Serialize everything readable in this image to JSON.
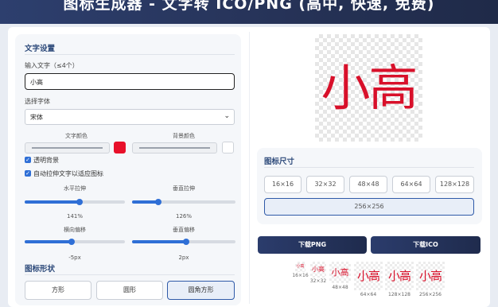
{
  "header": {
    "title": "图标生成器 - 文字转 ICO/PNG (高中, 快速, 免费)"
  },
  "text_settings": {
    "section_title": "文字设置",
    "input_label": "输入文字（≤4个）",
    "input_value": "小高",
    "font_label": "选择字体",
    "font_value": "宋体",
    "text_color_label": "文字颜色",
    "bg_color_label": "背景颜色",
    "text_color": "#e8102a",
    "bg_color": "#ffffff",
    "transparent_label": "透明背景",
    "transparent_checked": true,
    "autostretch_label": "自动拉伸文字以适应图标",
    "autostretch_checked": true,
    "h_stretch_label": "水平拉伸",
    "h_stretch_value": "141%",
    "v_stretch_label": "垂直拉伸",
    "v_stretch_value": "126%",
    "h_offset_label": "横向偏移",
    "h_offset_value": "-5px",
    "v_offset_label": "垂直偏移",
    "v_offset_value": "2px",
    "h_stretch_level": 0.55,
    "v_stretch_level": 0.25,
    "h_offset_level": 0.47,
    "v_offset_level": 0.52
  },
  "shape": {
    "section_title": "图标形状",
    "options": [
      "方形",
      "圆形",
      "圆角方形"
    ],
    "selected": "圆角方形"
  },
  "preview": {
    "text": "小高",
    "accent": "#d8102a"
  },
  "sizes": {
    "section_title": "图标尺寸",
    "options": [
      "16×16",
      "32×32",
      "48×48",
      "64×64",
      "128×128"
    ],
    "selected": "256×256"
  },
  "downloads": {
    "png_label": "下载PNG",
    "ico_label": "下载ICO"
  },
  "thumbnails": [
    {
      "text": "小高",
      "caption": "16×16"
    },
    {
      "text": "小高",
      "caption": "32×32"
    },
    {
      "text": "小高",
      "caption": "48×48"
    },
    {
      "text": "小高",
      "caption": "64×64"
    },
    {
      "text": "小高",
      "caption": "128×128"
    },
    {
      "text": "小高",
      "caption": "256×256"
    }
  ]
}
